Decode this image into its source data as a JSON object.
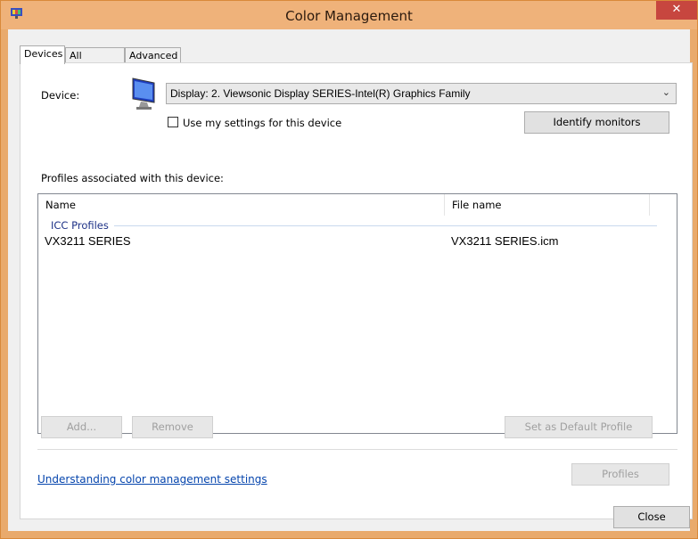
{
  "window": {
    "title": "Color Management",
    "close_glyph": "✕"
  },
  "tabs": [
    {
      "label": "Devices",
      "active": true
    },
    {
      "label": "All Profiles",
      "active": false
    },
    {
      "label": "Advanced",
      "active": false
    }
  ],
  "device": {
    "label": "Device:",
    "selected": "Display: 2. Viewsonic Display SERIES-Intel(R) Graphics Family",
    "icon": "monitor-icon",
    "use_settings_label": "Use my settings for this device",
    "use_settings_checked": false,
    "identify_label": "Identify monitors"
  },
  "profiles": {
    "section_label": "Profiles associated with this device:",
    "columns": [
      "Name",
      "File name"
    ],
    "group": "ICC Profiles",
    "rows": [
      {
        "name": "VX3211 SERIES",
        "file": "VX3211 SERIES.icm"
      }
    ]
  },
  "buttons": {
    "add": "Add...",
    "remove": "Remove",
    "set_default": "Set as Default Profile",
    "profiles": "Profiles",
    "close": "Close"
  },
  "link": {
    "understanding": "Understanding color management settings"
  },
  "colors": {
    "title_bar": "#efb27a",
    "close_button": "#c7463f",
    "link": "#0645ad",
    "group_label": "#1e3287"
  }
}
